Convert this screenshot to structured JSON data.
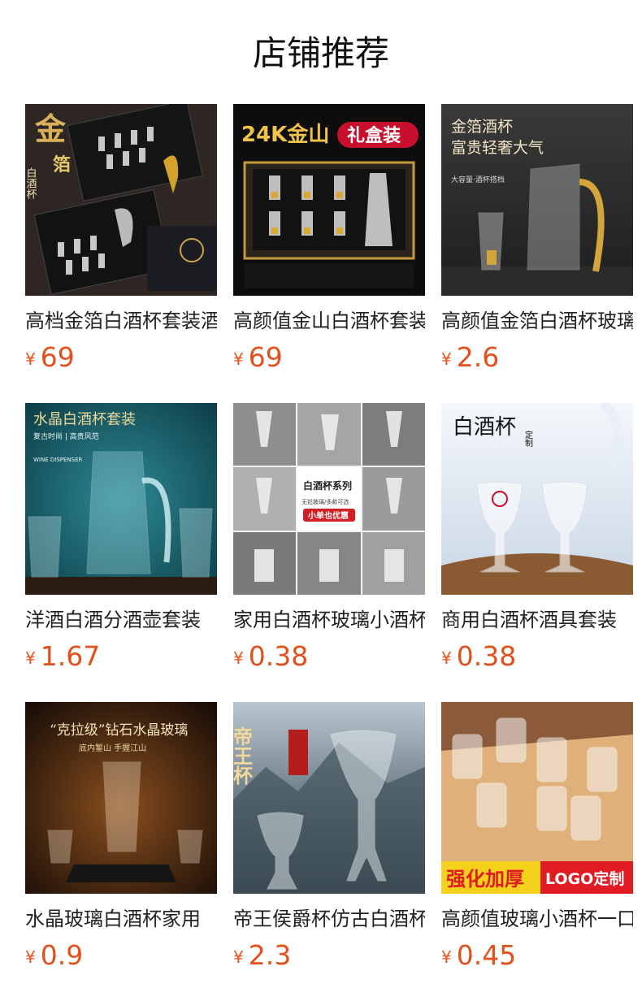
{
  "section_title": "店铺推荐",
  "products": [
    {
      "name": "高档金箔白酒杯套装酒具",
      "currency": "¥",
      "price": "69",
      "image_text": [
        "金",
        "箔",
        "白酒杯"
      ]
    },
    {
      "name": "高颜值金山白酒杯套装",
      "currency": "¥",
      "price": "69",
      "image_text": [
        "24K金山",
        "礼盒装"
      ]
    },
    {
      "name": "高颜值金箔白酒杯玻璃",
      "currency": "¥",
      "price": "2.6",
      "image_text": [
        "金箔酒杯",
        "富贵轻奢大气",
        "大容量·酒杯搭档"
      ]
    },
    {
      "name": "洋酒白酒分酒壶套装",
      "currency": "¥",
      "price": "1.67",
      "image_text": [
        "水晶白酒杯套装",
        "复古时尚 | 高贵风范",
        "WINE DISPENSER"
      ]
    },
    {
      "name": "家用白酒杯玻璃小酒杯",
      "currency": "¥",
      "price": "0.38",
      "image_text": [
        "白酒杯系列",
        "无铅玻璃/多款可选",
        "小单也优惠"
      ]
    },
    {
      "name": "商用白酒杯酒具套装",
      "currency": "¥",
      "price": "0.38",
      "image_text": [
        "白酒杯",
        "定制"
      ]
    },
    {
      "name": "水晶玻璃白酒杯家用",
      "currency": "¥",
      "price": "0.9",
      "image_text": [
        "“克拉级”钻石水晶玻璃",
        "底内錾山 手握江山"
      ]
    },
    {
      "name": "帝王侯爵杯仿古白酒杯",
      "currency": "¥",
      "price": "2.3",
      "image_text": [
        "帝王杯"
      ]
    },
    {
      "name": "高颜值玻璃小酒杯一口杯",
      "currency": "¥",
      "price": "0.45",
      "image_text": [
        "强化加厚",
        "LOGO定制"
      ]
    }
  ]
}
